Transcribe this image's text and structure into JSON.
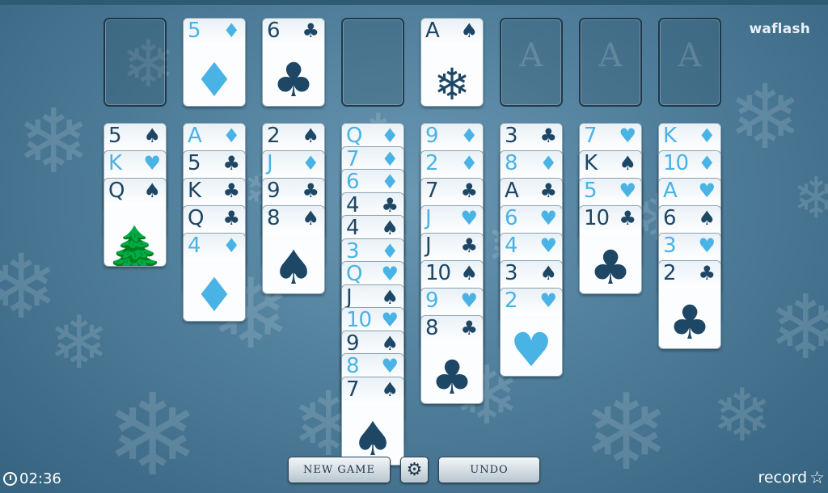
{
  "brand": "waflash",
  "timer": {
    "icon": "clock-icon",
    "value": "02:36"
  },
  "record": {
    "label": "record",
    "icon": "star-icon"
  },
  "buttons": {
    "new_game": "NEW GAME",
    "settings_icon": "gear-icon",
    "undo": "UNDO"
  },
  "colors": {
    "red_suit": "#4ab3e6",
    "black_suit": "#1e4665",
    "background": "#507f9c"
  },
  "free_cells": [
    {
      "rank": "",
      "suit": ""
    },
    {
      "rank": "5",
      "suit": "♦",
      "color": "red"
    },
    {
      "rank": "6",
      "suit": "♣",
      "color": "black"
    },
    {
      "rank": "",
      "suit": ""
    }
  ],
  "foundations": [
    {
      "rank": "A",
      "suit": "♠",
      "color": "black",
      "art": "snowflake"
    },
    {
      "placeholder": "A"
    },
    {
      "placeholder": "A"
    },
    {
      "placeholder": "A"
    }
  ],
  "tableau": [
    [
      {
        "r": "5",
        "s": "♠",
        "c": "black"
      },
      {
        "r": "K",
        "s": "♥",
        "c": "red"
      },
      {
        "r": "Q",
        "s": "♠",
        "c": "black",
        "art": "tree"
      }
    ],
    [
      {
        "r": "A",
        "s": "♦",
        "c": "red"
      },
      {
        "r": "5",
        "s": "♣",
        "c": "black"
      },
      {
        "r": "K",
        "s": "♣",
        "c": "black"
      },
      {
        "r": "Q",
        "s": "♣",
        "c": "black"
      },
      {
        "r": "4",
        "s": "♦",
        "c": "red"
      }
    ],
    [
      {
        "r": "2",
        "s": "♠",
        "c": "black"
      },
      {
        "r": "J",
        "s": "♦",
        "c": "red"
      },
      {
        "r": "9",
        "s": "♣",
        "c": "black"
      },
      {
        "r": "8",
        "s": "♠",
        "c": "black"
      }
    ],
    [
      {
        "r": "Q",
        "s": "♦",
        "c": "red"
      },
      {
        "r": "7",
        "s": "♦",
        "c": "red"
      },
      {
        "r": "6",
        "s": "♦",
        "c": "red"
      },
      {
        "r": "4",
        "s": "♣",
        "c": "black"
      },
      {
        "r": "4",
        "s": "♠",
        "c": "black"
      },
      {
        "r": "3",
        "s": "♦",
        "c": "red"
      },
      {
        "r": "Q",
        "s": "♥",
        "c": "red"
      },
      {
        "r": "J",
        "s": "♠",
        "c": "black"
      },
      {
        "r": "10",
        "s": "♥",
        "c": "red"
      },
      {
        "r": "9",
        "s": "♠",
        "c": "black"
      },
      {
        "r": "8",
        "s": "♥",
        "c": "red"
      },
      {
        "r": "7",
        "s": "♠",
        "c": "black"
      }
    ],
    [
      {
        "r": "9",
        "s": "♦",
        "c": "red"
      },
      {
        "r": "2",
        "s": "♦",
        "c": "red"
      },
      {
        "r": "7",
        "s": "♣",
        "c": "black"
      },
      {
        "r": "J",
        "s": "♥",
        "c": "red"
      },
      {
        "r": "J",
        "s": "♣",
        "c": "black"
      },
      {
        "r": "10",
        "s": "♠",
        "c": "black"
      },
      {
        "r": "9",
        "s": "♥",
        "c": "red"
      },
      {
        "r": "8",
        "s": "♣",
        "c": "black"
      }
    ],
    [
      {
        "r": "3",
        "s": "♣",
        "c": "black"
      },
      {
        "r": "8",
        "s": "♦",
        "c": "red"
      },
      {
        "r": "A",
        "s": "♣",
        "c": "black"
      },
      {
        "r": "6",
        "s": "♥",
        "c": "red"
      },
      {
        "r": "4",
        "s": "♥",
        "c": "red"
      },
      {
        "r": "3",
        "s": "♠",
        "c": "black"
      },
      {
        "r": "2",
        "s": "♥",
        "c": "red"
      }
    ],
    [
      {
        "r": "7",
        "s": "♥",
        "c": "red"
      },
      {
        "r": "K",
        "s": "♠",
        "c": "black"
      },
      {
        "r": "5",
        "s": "♥",
        "c": "red"
      },
      {
        "r": "10",
        "s": "♣",
        "c": "black"
      }
    ],
    [
      {
        "r": "K",
        "s": "♦",
        "c": "red"
      },
      {
        "r": "10",
        "s": "♦",
        "c": "red"
      },
      {
        "r": "A",
        "s": "♥",
        "c": "red"
      },
      {
        "r": "6",
        "s": "♠",
        "c": "black"
      },
      {
        "r": "3",
        "s": "♥",
        "c": "red"
      },
      {
        "r": "2",
        "s": "♣",
        "c": "black"
      }
    ]
  ]
}
